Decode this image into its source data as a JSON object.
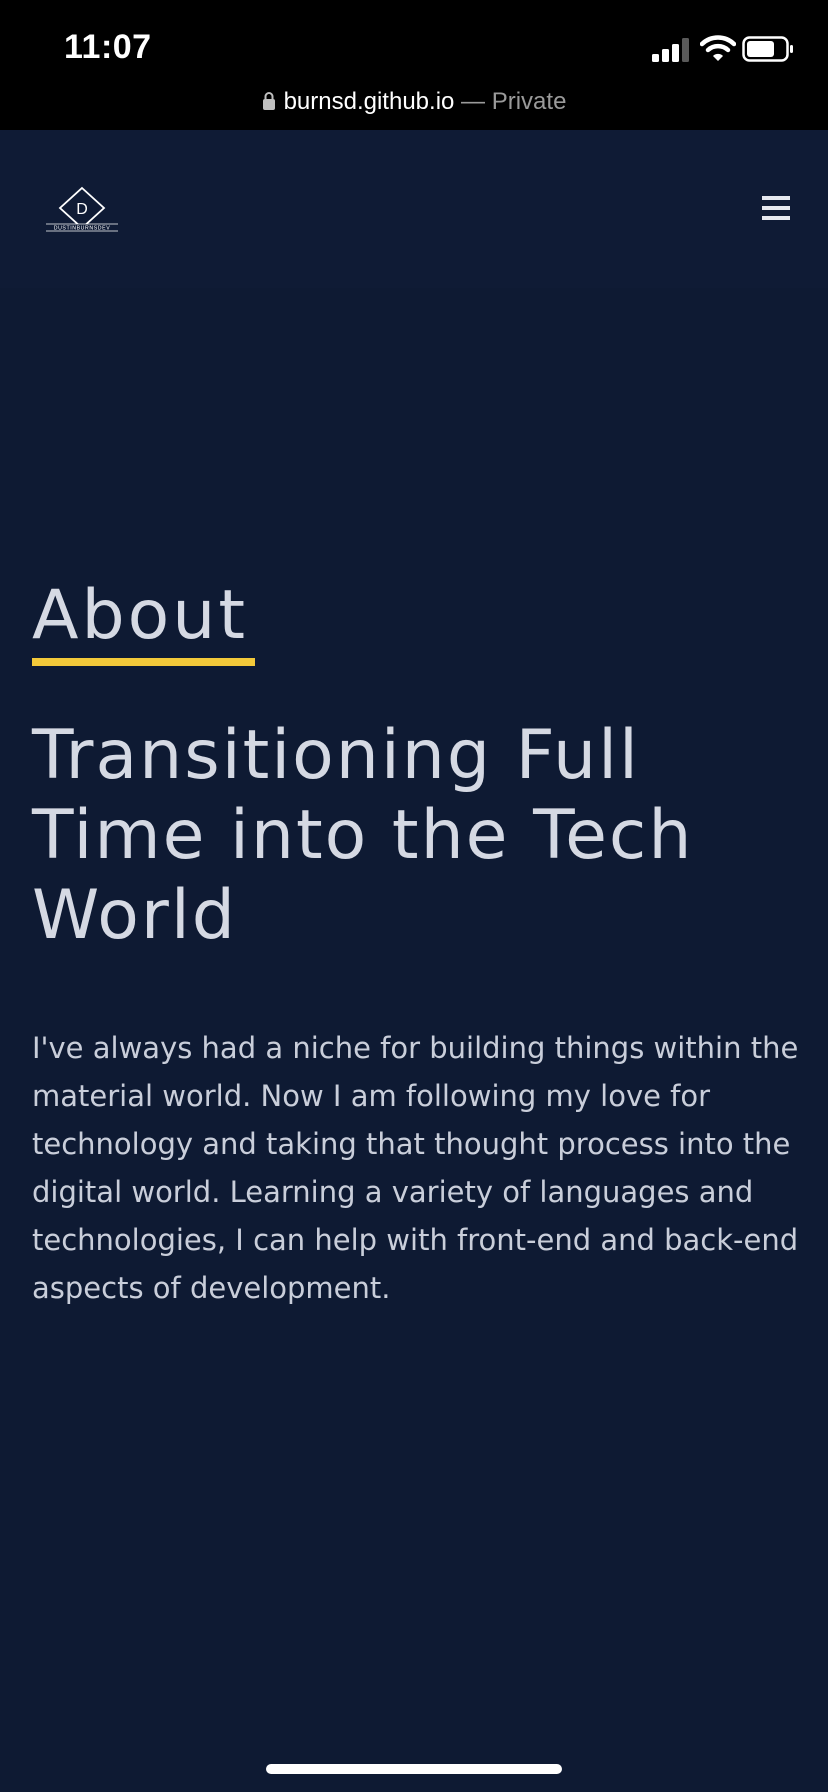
{
  "status_bar": {
    "time": "11:07",
    "url": "burnsd.github.io",
    "url_separator": " — ",
    "mode": "Private"
  },
  "header": {
    "logo_letter": "D",
    "logo_text": "DUSTINBURNSDEV",
    "menu_icon": "hamburger-menu-icon"
  },
  "main": {
    "section_label": "About",
    "title": "Transitioning Full Time into the Tech World",
    "bio": "I've always had a niche for building things within the material world. Now I am following my love for technology and taking that thought process into the digital world. Learning a variety of languages and technologies, I can help with front-end and back-end aspects of development."
  },
  "colors": {
    "background": "#0e1a33",
    "header_background": "#0f1b35",
    "accent_underline": "#f3c93a",
    "text": "#d5d9e3"
  }
}
